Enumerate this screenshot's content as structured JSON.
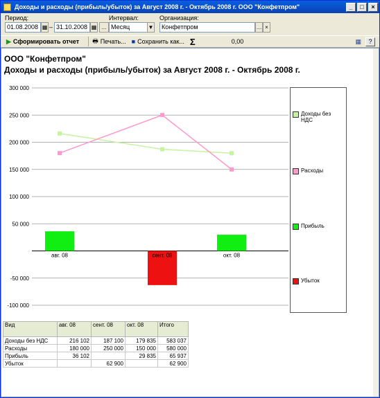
{
  "window": {
    "title": "Доходы и расходы (прибыль/убыток) за Август 2008 г. - Октябрь 2008 г. ООО \"Конфетпром\"",
    "minimize": "_",
    "maximize": "□",
    "close": "×"
  },
  "params": {
    "period_label": "Период:",
    "date_from": "01.08.2008",
    "dash": "–",
    "date_to": "31.10.2008",
    "more": "...",
    "interval_label": "Интервал:",
    "interval_value": "Месяц",
    "org_label": "Организация:",
    "org_value": "Конфетпром"
  },
  "toolbar": {
    "generate": "Сформировать отчет",
    "print": "Печать...",
    "save": "Сохранить как...",
    "sum_value": "0,00",
    "help": "?"
  },
  "report": {
    "org": "ООО \"Конфетпром\"",
    "title": "Доходы и расходы (прибыль/убыток) за Август 2008 г. - Октябрь 2008 г."
  },
  "chart_data": {
    "type": "bar",
    "categories": [
      "авг. 08",
      "сент. 08",
      "окт. 08"
    ],
    "ylim": [
      -100000,
      300000
    ],
    "yticks": [
      "300 000",
      "250 000",
      "200 000",
      "150 000",
      "100 000",
      "50 000",
      "",
      "-50 000",
      "-100 000"
    ],
    "ytick_values": [
      300000,
      250000,
      200000,
      150000,
      100000,
      50000,
      0,
      -50000,
      -100000
    ],
    "series": [
      {
        "name": "Доходы без НДС",
        "kind": "line",
        "color": "#c6f3a0",
        "values": [
          216102,
          187100,
          179835
        ]
      },
      {
        "name": "Расходы",
        "kind": "line",
        "color": "#ff99cc",
        "values": [
          180000,
          250000,
          150000
        ]
      },
      {
        "name": "Прибыль",
        "kind": "bar",
        "color": "#11ee11",
        "values": [
          36102,
          0,
          29835
        ]
      },
      {
        "name": "Убыток",
        "kind": "bar",
        "color": "#ee1111",
        "values": [
          0,
          -62900,
          0
        ]
      }
    ],
    "legend_position": "right"
  },
  "legend": [
    {
      "label": "Доходы без НДС",
      "color": "#c6f3a0"
    },
    {
      "label": "Расходы",
      "color": "#ff99cc"
    },
    {
      "label": "Прибыль",
      "color": "#11ee11"
    },
    {
      "label": "Убыток",
      "color": "#ee1111"
    }
  ],
  "table": {
    "headers": [
      "Вид",
      "авг. 08",
      "сент. 08",
      "окт. 08",
      "Итого"
    ],
    "rows": [
      [
        "Доходы без НДС",
        "216 102",
        "187 100",
        "179 835",
        "583 037"
      ],
      [
        "Расходы",
        "180 000",
        "250 000",
        "150 000",
        "580 000"
      ],
      [
        "Прибыль",
        "36 102",
        "",
        "29 835",
        "65 937"
      ],
      [
        "Убыток",
        "",
        "62 900",
        "",
        "62 900"
      ]
    ]
  }
}
